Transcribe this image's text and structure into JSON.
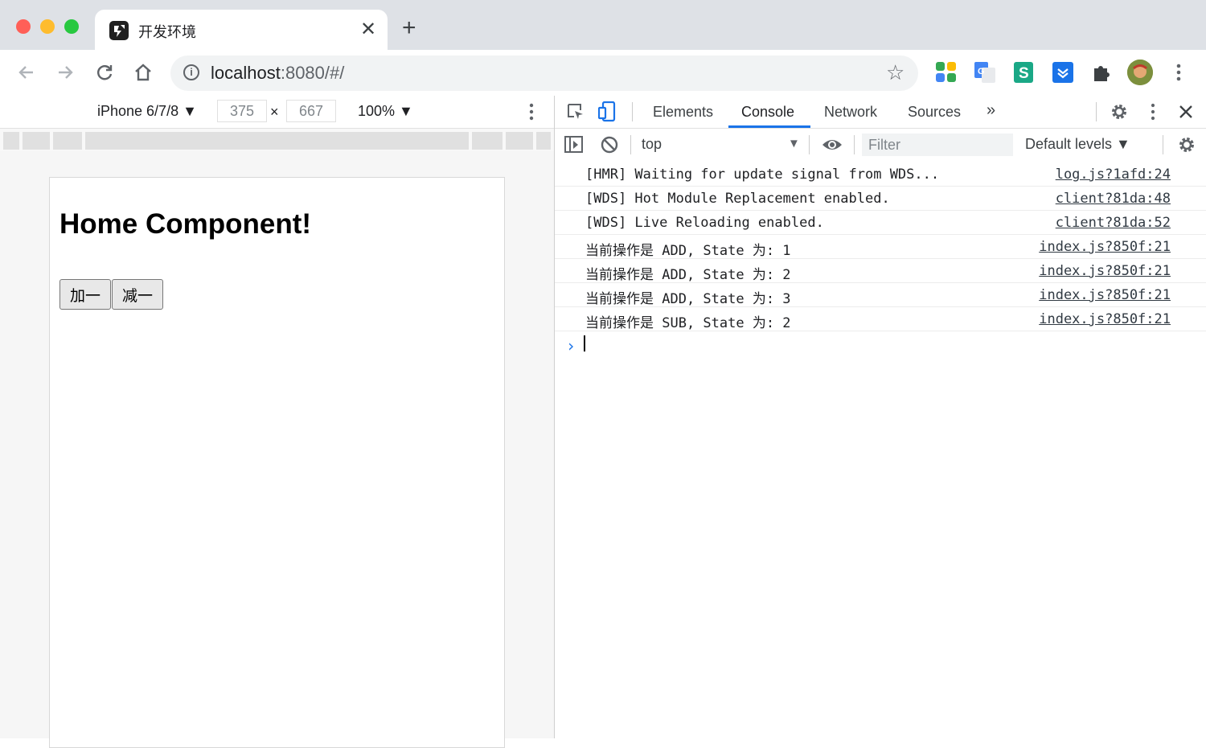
{
  "browser": {
    "tab_title": "开发环境",
    "tab_close": "✕",
    "new_tab": "+",
    "url_host": "localhost",
    "url_rest": ":8080/#/",
    "icons": {
      "back": "back-arrow-icon",
      "forward": "forward-arrow-icon",
      "reload": "reload-icon",
      "home": "home-icon",
      "info": "info-icon",
      "star": "star-icon",
      "menu": "kebab-menu-icon"
    }
  },
  "device_toolbar": {
    "device": "iPhone 6/7/8 ▼",
    "width": "375",
    "height": "667",
    "times": "×",
    "zoom": "100% ▼"
  },
  "page": {
    "heading": "Home Component!",
    "btn_add": "加一",
    "btn_sub": "减一"
  },
  "devtools": {
    "tabs": [
      "Elements",
      "Console",
      "Network",
      "Sources",
      "»"
    ],
    "active_tab": "Console",
    "context": "top",
    "filter_placeholder": "Filter",
    "levels": "Default levels ▼",
    "accent": "#1a73e8"
  },
  "console": {
    "rows": [
      {
        "msg": "[HMR] Waiting for update signal from WDS...",
        "src": "log.js?1afd:24"
      },
      {
        "msg": "[WDS] Hot Module Replacement enabled.",
        "src": "client?81da:48"
      },
      {
        "msg": "[WDS] Live Reloading enabled.",
        "src": "client?81da:52"
      },
      {
        "msg": "当前操作是 ADD, State 为: 1",
        "src": "index.js?850f:21"
      },
      {
        "msg": "当前操作是 ADD, State 为: 2",
        "src": "index.js?850f:21"
      },
      {
        "msg": "当前操作是 ADD, State 为: 3",
        "src": "index.js?850f:21"
      },
      {
        "msg": "当前操作是 SUB, State 为: 2",
        "src": "index.js?850f:21"
      }
    ],
    "prompt": "›"
  }
}
